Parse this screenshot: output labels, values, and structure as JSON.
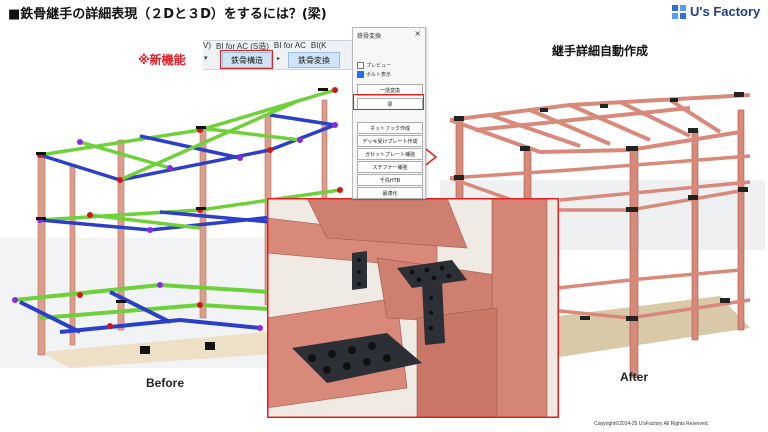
{
  "slide": {
    "title": "■鉄骨継手の詳細表現（２Dと３D）をするには？(梁)",
    "logo_text": "U's Factory",
    "new_feature": "※新機能",
    "after_title": "継手詳細自動作成",
    "before_label": "Before",
    "after_label": "After",
    "copyright": "Copyright©2014-25  U'sFactory All Rights Reserved."
  },
  "ribbon": {
    "tabs": [
      "V)",
      "BI for AC (S造)",
      "BI for AC",
      "BI(K"
    ],
    "buttons": [
      "鉄骨構造",
      "鉄骨変換"
    ]
  },
  "dialog": {
    "title": "鉄骨変換",
    "close": "×",
    "checkboxes": [
      {
        "label": "プレビュー",
        "checked": false
      },
      {
        "label": "ボルト表示",
        "checked": true
      }
    ],
    "buttons": [
      "一括変換",
      "梁",
      "ネットフック作成",
      "デッキ受けプレート作成",
      "ガセットプレート補強",
      "スチフナー補強",
      "千鳥HTB",
      "最適化"
    ]
  },
  "colors": {
    "accent_red": "#e02020",
    "steel_after": "#d9897a",
    "beam_before_green": "#6fd13a",
    "beam_before_blue": "#2b3fc8",
    "column": "#e0a08e",
    "ribbon_button": "#cfe4f6"
  }
}
